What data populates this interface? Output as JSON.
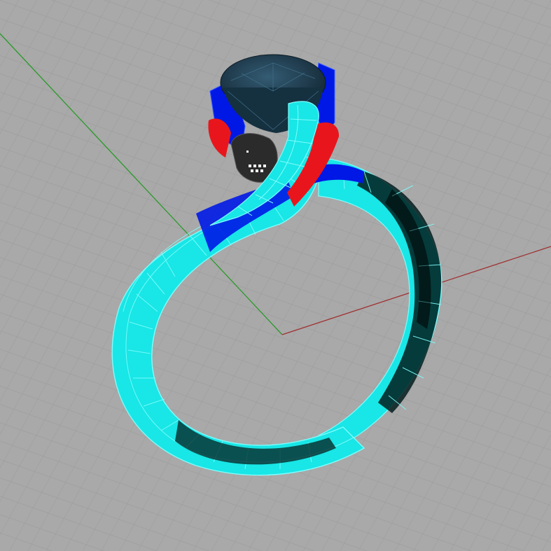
{
  "viewport": {
    "view_type": "perspective",
    "display_mode": "shaded-with-wireframe",
    "background_color": "#a9a9a9",
    "grid": true,
    "grid_color": "#9a9a9a",
    "axis_colors": {
      "x": "#a03030",
      "y": "#2a9a2a"
    }
  },
  "model": {
    "object": "ring",
    "parts": [
      {
        "name": "band",
        "color": "#19e6e6",
        "wire_color": "#7ffcfc"
      },
      {
        "name": "gemstone",
        "color": "#1c3d52"
      },
      {
        "name": "prongs",
        "color": "#0018e6"
      },
      {
        "name": "side-accents",
        "color": "#e8161c"
      },
      {
        "name": "center-setting",
        "color": "#2b2b2b"
      }
    ]
  }
}
